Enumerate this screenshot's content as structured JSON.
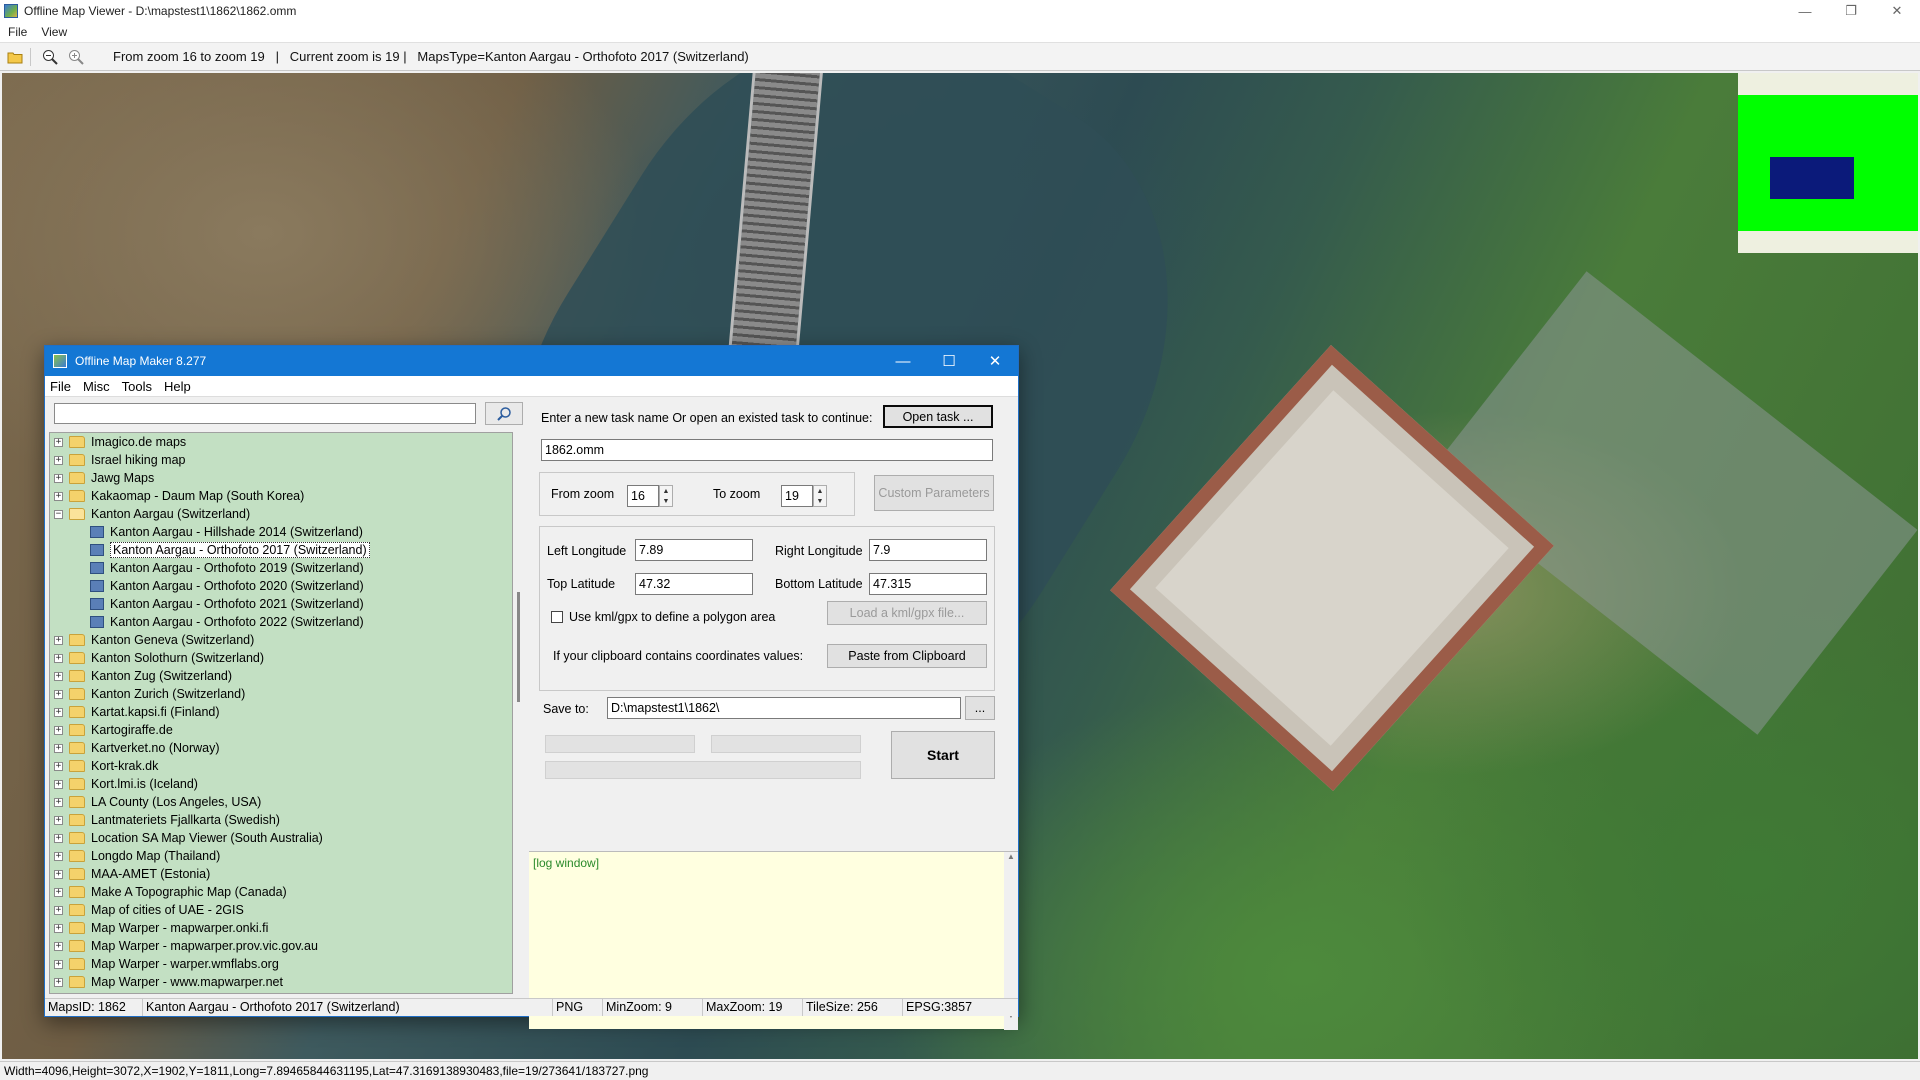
{
  "viewer": {
    "title": "Offline Map Viewer - D:\\mapstest1\\1862\\1862.omm",
    "menu": [
      "File",
      "View"
    ],
    "toolbar_text": "From zoom 16 to zoom 19   |   Current zoom is 19 |   MapsType=Kanton Aargau - Orthofoto 2017 (Switzerland)",
    "status": "Width=4096,Height=3072,X=1902,Y=1811,Long=7.89465844631195,Lat=47.3169138930483,file=19/273641/183727.png",
    "overview_colors": {
      "fill": "#00ff00",
      "viewport": "#0b1a7a"
    }
  },
  "dialog": {
    "title": "Offline Map Maker 8.277",
    "menu": [
      "File",
      "Misc",
      "Tools",
      "Help"
    ],
    "search_value": "",
    "tree": [
      {
        "label": "Imagico.de maps",
        "type": "folder"
      },
      {
        "label": "Israel hiking map",
        "type": "folder"
      },
      {
        "label": "Jawg Maps",
        "type": "folder"
      },
      {
        "label": "Kakaomap - Daum Map (South Korea)",
        "type": "folder"
      },
      {
        "label": "Kanton Aargau (Switzerland)",
        "type": "folder-open"
      },
      {
        "label": "Kanton Aargau - Hillshade 2014 (Switzerland)",
        "type": "map"
      },
      {
        "label": "Kanton Aargau - Orthofoto 2017 (Switzerland)",
        "type": "map",
        "selected": true
      },
      {
        "label": "Kanton Aargau - Orthofoto 2019 (Switzerland)",
        "type": "map"
      },
      {
        "label": "Kanton Aargau - Orthofoto 2020 (Switzerland)",
        "type": "map"
      },
      {
        "label": "Kanton Aargau - Orthofoto 2021 (Switzerland)",
        "type": "map"
      },
      {
        "label": "Kanton Aargau - Orthofoto 2022 (Switzerland)",
        "type": "map"
      },
      {
        "label": "Kanton Geneva (Switzerland)",
        "type": "folder"
      },
      {
        "label": "Kanton Solothurn (Switzerland)",
        "type": "folder"
      },
      {
        "label": "Kanton Zug (Switzerland)",
        "type": "folder"
      },
      {
        "label": "Kanton Zurich (Switzerland)",
        "type": "folder"
      },
      {
        "label": "Kartat.kapsi.fi (Finland)",
        "type": "folder"
      },
      {
        "label": "Kartogiraffe.de",
        "type": "folder"
      },
      {
        "label": "Kartverket.no (Norway)",
        "type": "folder"
      },
      {
        "label": "Kort-krak.dk",
        "type": "folder"
      },
      {
        "label": "Kort.lmi.is (Iceland)",
        "type": "folder"
      },
      {
        "label": "LA County (Los Angeles, USA)",
        "type": "folder"
      },
      {
        "label": "Lantmateriets Fjallkarta (Swedish)",
        "type": "folder"
      },
      {
        "label": "Location SA Map Viewer (South Australia)",
        "type": "folder"
      },
      {
        "label": "Longdo Map (Thailand)",
        "type": "folder"
      },
      {
        "label": "MAA-AMET (Estonia)",
        "type": "folder"
      },
      {
        "label": "Make A Topographic Map (Canada)",
        "type": "folder"
      },
      {
        "label": "Map of cities of UAE - 2GIS",
        "type": "folder"
      },
      {
        "label": "Map Warper - mapwarper.onki.fi",
        "type": "folder"
      },
      {
        "label": "Map Warper - mapwarper.prov.vic.gov.au",
        "type": "folder"
      },
      {
        "label": "Map Warper - warper.wmflabs.org",
        "type": "folder"
      },
      {
        "label": "Map Warper - www.mapwarper.net",
        "type": "folder"
      }
    ],
    "task_prompt": "Enter a new task name Or open an existed task to continue:",
    "open_task_label": "Open task ...",
    "task_name": "1862.omm",
    "from_zoom_label": "From zoom",
    "from_zoom": "16",
    "to_zoom_label": "To zoom",
    "to_zoom": "19",
    "custom_params_label": "Custom Parameters",
    "left_lon_label": "Left Longitude",
    "left_lon": "7.89",
    "right_lon_label": "Right Longitude",
    "right_lon": "7.9",
    "top_lat_label": "Top Latitude",
    "top_lat": "47.32",
    "bottom_lat_label": "Bottom Latitude",
    "bottom_lat": "47.315",
    "kml_label": "Use kml/gpx to define a polygon area",
    "load_kml_label": "Load a kml/gpx file...",
    "clipboard_hint": "If your clipboard contains coordinates values:",
    "paste_label": "Paste from Clipboard",
    "save_to_label": "Save to:",
    "save_to": "D:\\mapstest1\\1862\\",
    "browse_label": "...",
    "start_label": "Start",
    "log_text": "[log window]",
    "status": {
      "maps_id": "MapsID: 1862",
      "maps_name": "Kanton Aargau - Orthofoto 2017 (Switzerland)",
      "format": "PNG",
      "min_zoom": "MinZoom: 9",
      "max_zoom": "MaxZoom: 19",
      "tile_size": "TileSize: 256",
      "epsg": "EPSG:3857"
    }
  }
}
